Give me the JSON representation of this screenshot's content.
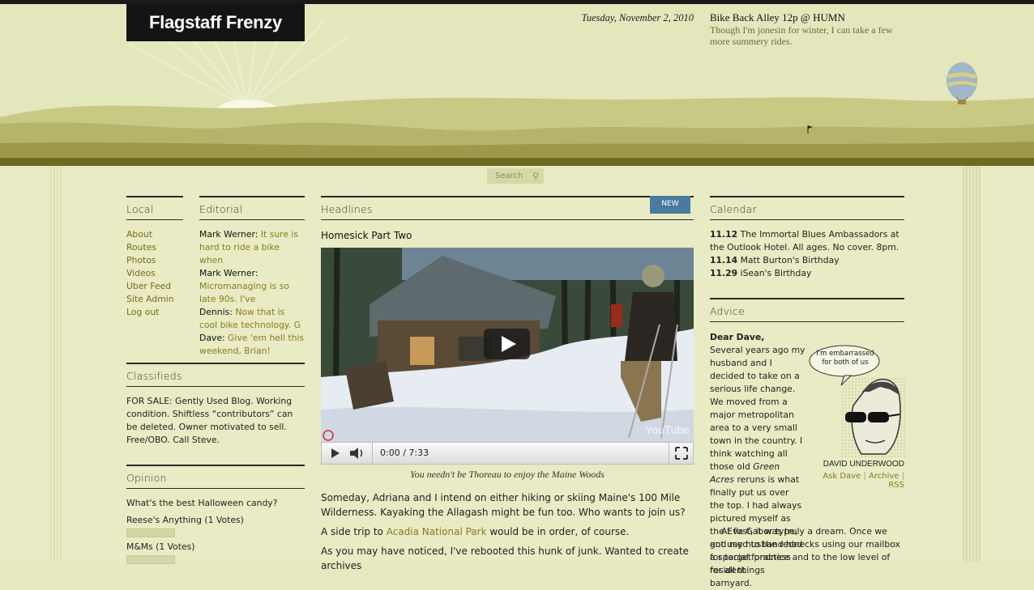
{
  "header": {
    "site_title": "Flagstaff Frenzy",
    "date": "Tuesday, November 2, 2010",
    "tweet_title": "Bike Back Alley 12p @ HUMN",
    "tweet_body": "Though I'm jonesin for winter, I can take a few more summery rides."
  },
  "search": {
    "placeholder": "Search"
  },
  "local": {
    "title": "Local",
    "links": [
      "About",
      "Routes",
      "Photos",
      "Videos",
      "Uber Feed",
      "Site Admin",
      "Log out"
    ]
  },
  "editorial": {
    "title": "Editorial",
    "entries": [
      {
        "author": "Mark Werner:",
        "text": "It sure is hard to ride a bike when"
      },
      {
        "author": "Mark Werner:",
        "text": "Micromanaging is so late 90s. I've"
      },
      {
        "author": "Dennis:",
        "text": "Now that is cool bike technology. G"
      },
      {
        "author": "Dave:",
        "text": "Give 'em hell this weekend, Brian!"
      }
    ]
  },
  "classifieds": {
    "title": "Classifieds",
    "label": "FOR SALE",
    "text": ": Gently Used Blog. Working condition. Shiftless “contributors” can be deleted. Owner motivated to sell. Free/OBO. Call Steve."
  },
  "opinion": {
    "title": "Opinion",
    "question": "What's the best Halloween candy?",
    "options": [
      {
        "label": "Reese's Anything (1 Votes)",
        "share": 0.5
      },
      {
        "label": "M&Ms (1 Votes)",
        "share": 0.5
      }
    ]
  },
  "headlines": {
    "title": "Headlines",
    "badge": "NEW",
    "post_title": "Homesick Part Two",
    "video_time": "0:00 / 7:33",
    "video_watermark": "YouTube",
    "caption": "You needn't be Thoreau to enjoy the Maine Woods",
    "p1": "Someday, Adriana and I intend on either hiking or skiing Maine's 100 Mile Wilderness. Kayaking the Allagash might be fun too. Who wants to join us?",
    "p2_before": "A side trip to ",
    "p2_link": "Acadia National Park",
    "p2_after": " would be in order, of course.",
    "p3": "As you may have noticed, I've rebooted this hunk of junk. Wanted to create archives"
  },
  "calendar": {
    "title": "Calendar",
    "events": [
      {
        "date": "11.12",
        "text": "The Immortal Blues Ambassadors at the Outlook Hotel. All ages. No cover. 8pm."
      },
      {
        "date": "11.14",
        "text": "Matt Burton's Birthday"
      },
      {
        "date": "11.29",
        "text": "iSean's Birthday"
      }
    ]
  },
  "advice": {
    "title": "Advice",
    "salutation": "Dear Dave,",
    "letter_1": "Several years ago my husband and I decided to take on a serious life change. We moved from a major metropolitan area to a very small town in the country. I think watching all those old",
    "letter_italic": "Green Acres",
    "letter_2": " reruns is what finally put us over the top. I had always pictured myself as the Eva Gabor type, and my husband had a special fondness for all things barnyard.",
    "letter_3": "At first, it was truly a dream. Once we got used to the rednecks using our mailbox for target practice and to the low level of resident",
    "bubble": "I'm embarrassed for both of us",
    "name": "DAVID UNDERWOOD",
    "links": [
      "Ask Dave",
      "Archive",
      "RSS"
    ]
  }
}
